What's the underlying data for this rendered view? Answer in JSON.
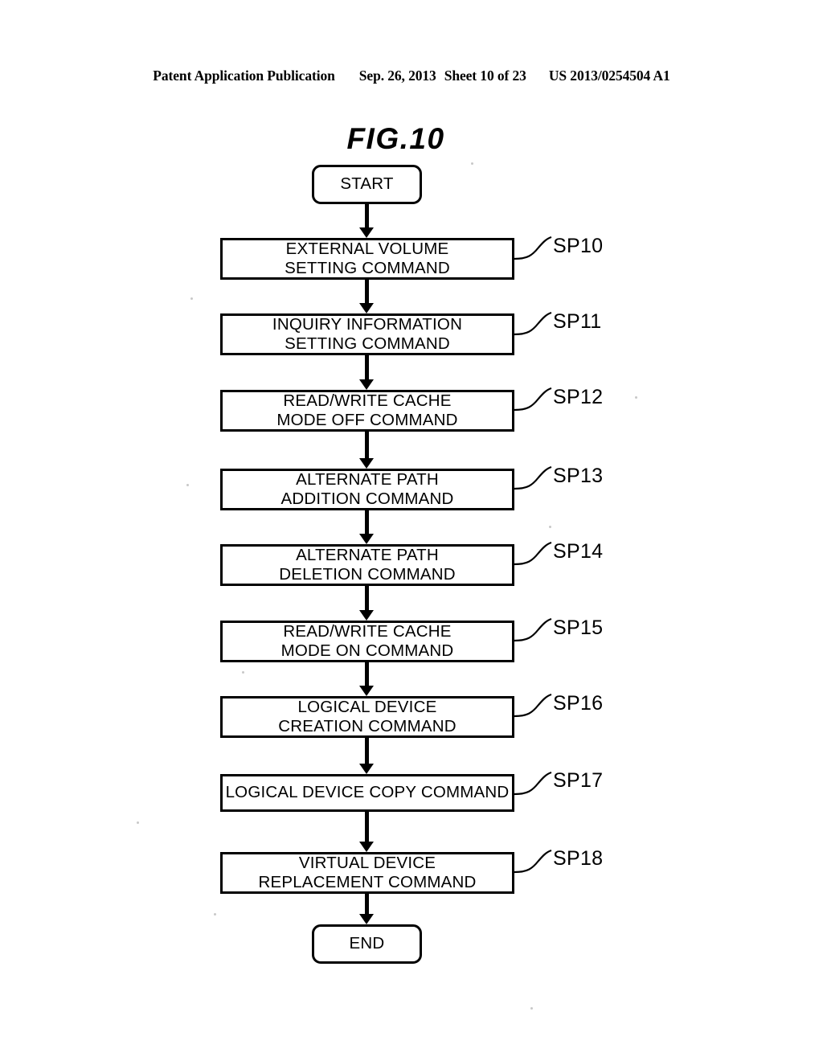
{
  "header": {
    "publication": "Patent Application Publication",
    "date": "Sep. 26, 2013",
    "sheet": "Sheet 10 of 23",
    "docnum": "US 2013/0254504 A1"
  },
  "figure": {
    "title": "FIG.10",
    "start_label": "START",
    "end_label": "END",
    "steps": [
      {
        "id": "SP10",
        "text": "EXTERNAL VOLUME\nSETTING COMMAND"
      },
      {
        "id": "SP11",
        "text": "INQUIRY INFORMATION\nSETTING COMMAND"
      },
      {
        "id": "SP12",
        "text": "READ/WRITE CACHE\nMODE OFF COMMAND"
      },
      {
        "id": "SP13",
        "text": "ALTERNATE PATH\nADDITION COMMAND"
      },
      {
        "id": "SP14",
        "text": "ALTERNATE PATH\nDELETION COMMAND"
      },
      {
        "id": "SP15",
        "text": "READ/WRITE CACHE\nMODE ON COMMAND"
      },
      {
        "id": "SP16",
        "text": "LOGICAL DEVICE\nCREATION COMMAND"
      },
      {
        "id": "SP17",
        "text": "LOGICAL DEVICE COPY COMMAND"
      },
      {
        "id": "SP18",
        "text": "VIRTUAL DEVICE\nREPLACEMENT COMMAND"
      }
    ]
  },
  "style": {
    "ink": "#000000",
    "paper": "#ffffff"
  }
}
